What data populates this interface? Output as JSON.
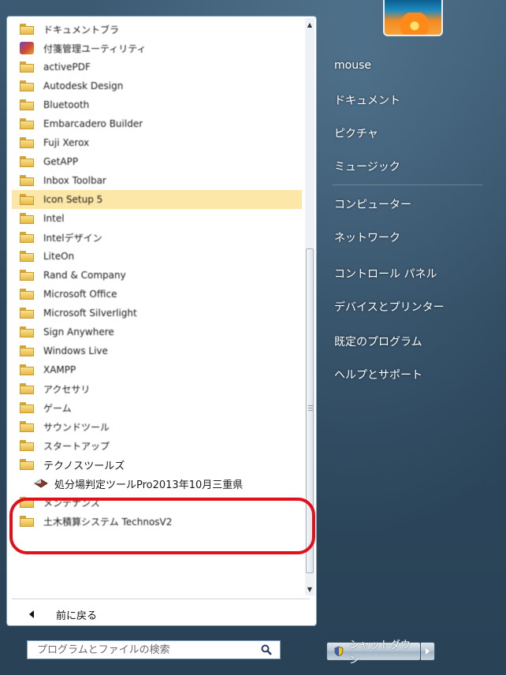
{
  "programs": [
    {
      "label": "ドキュメントブラ",
      "icon": "folder-icon",
      "highlighted": false
    },
    {
      "label": "付箋管理ユーティリティ",
      "icon": "app-icon",
      "highlighted": false
    },
    {
      "label": "activePDF",
      "icon": "folder-icon",
      "highlighted": false
    },
    {
      "label": "Autodesk Design",
      "icon": "folder-icon",
      "highlighted": false
    },
    {
      "label": "Bluetooth",
      "icon": "folder-icon",
      "highlighted": false
    },
    {
      "label": "Embarcadero Builder",
      "icon": "folder-icon",
      "highlighted": false
    },
    {
      "label": "Fuji Xerox",
      "icon": "folder-icon",
      "highlighted": false
    },
    {
      "label": "GetAPP",
      "icon": "folder-icon",
      "highlighted": false
    },
    {
      "label": "Inbox Toolbar",
      "icon": "folder-icon",
      "highlighted": false
    },
    {
      "label": "Icon Setup 5",
      "icon": "folder-icon",
      "highlighted": true
    },
    {
      "label": "Intel",
      "icon": "folder-icon",
      "highlighted": false
    },
    {
      "label": "Intelデザイン",
      "icon": "folder-icon",
      "highlighted": false
    },
    {
      "label": "LiteOn",
      "icon": "folder-icon",
      "highlighted": false
    },
    {
      "label": "Rand & Company",
      "icon": "folder-icon",
      "highlighted": false
    },
    {
      "label": "Microsoft Office",
      "icon": "folder-icon",
      "highlighted": false
    },
    {
      "label": "Microsoft Silverlight",
      "icon": "folder-icon",
      "highlighted": false
    },
    {
      "label": "Sign Anywhere",
      "icon": "folder-icon",
      "highlighted": false
    },
    {
      "label": "Windows Live",
      "icon": "folder-icon",
      "highlighted": false
    },
    {
      "label": "XAMPP",
      "icon": "folder-icon",
      "highlighted": false
    },
    {
      "label": "アクセサリ",
      "icon": "folder-icon",
      "highlighted": false
    },
    {
      "label": "ゲーム",
      "icon": "folder-icon",
      "highlighted": false
    },
    {
      "label": "サウンドツール",
      "icon": "folder-icon",
      "highlighted": false
    },
    {
      "label": "スタートアップ",
      "icon": "folder-icon",
      "highlighted": false
    },
    {
      "label": "テクノスツールズ",
      "icon": "folder-icon",
      "highlighted": false
    },
    {
      "label": "処分場判定ツールPro2013年10月三重県",
      "icon": "app-icon",
      "highlighted": false,
      "indent": true
    },
    {
      "label": "メンテナンス",
      "icon": "folder-icon",
      "highlighted": false
    },
    {
      "label": "土木積算システム TechnosV2",
      "icon": "folder-icon",
      "highlighted": false
    }
  ],
  "back_label": "前に戻る",
  "search": {
    "placeholder": "プログラムとファイルの検索",
    "value": ""
  },
  "right_panel": {
    "items": [
      "mouse",
      "ドキュメント",
      "ピクチャ",
      "ミュージック",
      "コンピューター",
      "ネットワーク",
      "コントロール パネル",
      "デバイスとプリンター",
      "既定のプログラム",
      "ヘルプとサポート"
    ]
  },
  "shutdown_label": "シャットダウン",
  "colors": {
    "highlight": "#fce7a8",
    "annotation_red": "#e3101b",
    "panel_blue": "#2c475d"
  }
}
